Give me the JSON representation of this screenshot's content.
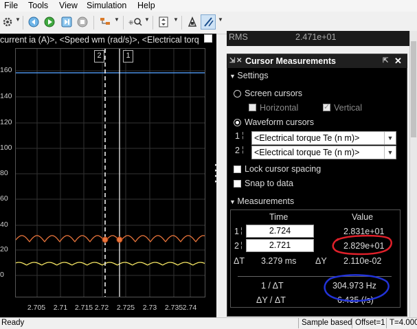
{
  "menu": {
    "items": [
      {
        "label": "File"
      },
      {
        "label": "Tools"
      },
      {
        "label": "View"
      },
      {
        "label": "Simulation"
      },
      {
        "label": "Help"
      }
    ]
  },
  "scope": {
    "title": "current ia (A)>, <Speed wm (rad/s)>, <Electrical torq",
    "y_ticks": [
      "160",
      "140",
      "120",
      "100",
      "80",
      "60",
      "40",
      "20",
      "0"
    ],
    "x_ticks": [
      "2.705",
      "2.71",
      "2.715",
      "2.72",
      "2.725",
      "2.73",
      "2.735",
      "2.74"
    ],
    "cursor1_label": "1",
    "cursor2_label": "2"
  },
  "rms": {
    "label": "RMS",
    "value": "2.471e+01"
  },
  "cursor_measurements": {
    "title": "Cursor Measurements",
    "settings_label": "Settings",
    "screen_cursors_label": "Screen cursors",
    "horizontal_label": "Horizontal",
    "vertical_label": "Vertical",
    "waveform_cursors_label": "Waveform cursors",
    "cursor1_index": "1",
    "cursor2_index": "2",
    "cursor1_signal": "<Electrical torque Te (n m)>",
    "cursor2_signal": "<Electrical torque Te (n m)>",
    "lock_spacing_label": "Lock cursor spacing",
    "snap_label": "Snap to data",
    "measurements_label": "Measurements",
    "time_header": "Time",
    "value_header": "Value",
    "row1_index": "1",
    "row1_time": "2.724",
    "row1_value": "2.831e+01",
    "row2_index": "2",
    "row2_time": "2.721",
    "row2_value": "2.829e+01",
    "delta_t_label": "ΔT",
    "delta_t_value": "3.279 ms",
    "delta_y_label": "ΔY",
    "delta_y_value": "2.110e-02",
    "inv_dt_label": "1 / ΔT",
    "inv_dt_value": "304.973 Hz",
    "dy_dt_label": "ΔY / ΔT",
    "dy_dt_value": "6.435 (/s)"
  },
  "status": {
    "ready": "Ready",
    "sample_based": "Sample based",
    "offset": "Offset=1",
    "time": "T=4.000"
  },
  "colors": {
    "blue_trace": "#4a90e2",
    "orange_trace": "#e8743b",
    "yellow_trace": "#f5e663",
    "red_annotation": "#e0202a",
    "blue_annotation": "#2233d8"
  }
}
